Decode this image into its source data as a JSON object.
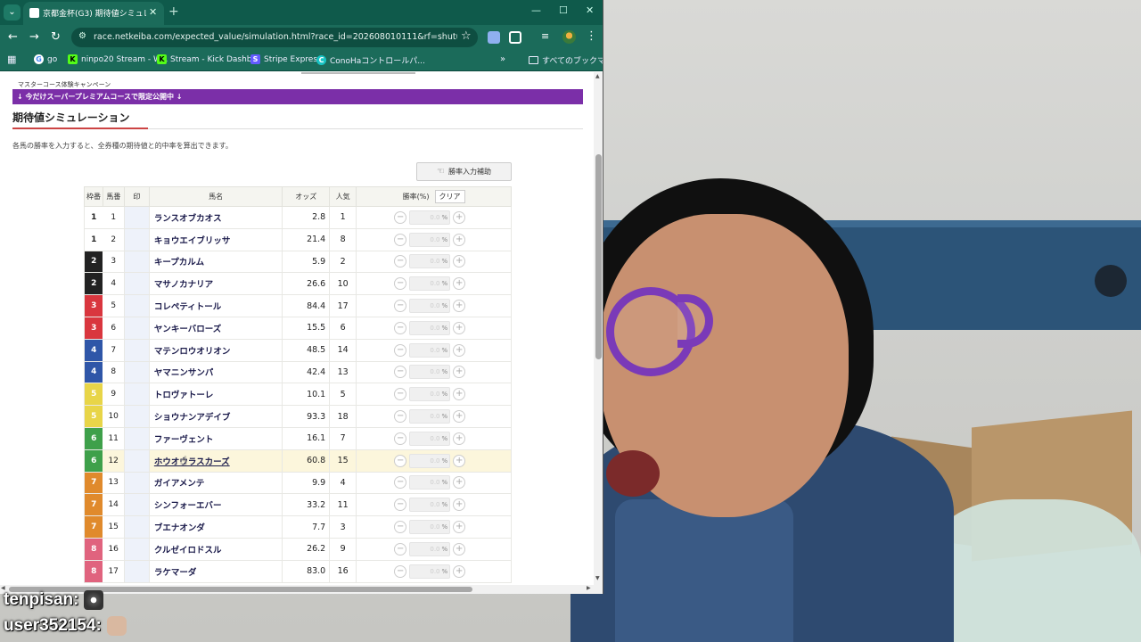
{
  "browser": {
    "tab_title": "京都金杯(G3) 期待値シミュレーショ",
    "tab_close": "✕",
    "new_tab": "+",
    "url": "race.netkeiba.com/expected_value/simulation.html?race_id=202608010111&rf=shutuba_submenu",
    "bookmarks": [
      "go",
      "ninpo20 Stream - W...",
      "Stream - Kick Dashb...",
      "Stripe Express",
      "ConoHaコントロールパ..."
    ],
    "bookmark_more": "»",
    "bookmark_folder": "すべてのブックマーク"
  },
  "page": {
    "campaign_label": "マスターコース体験キャンペーン",
    "premium_banner": "↓ 今だけスーパープレミアムコースで限定公開中 ↓",
    "title": "期待値シミュレーション",
    "description": "各馬の勝率を入力すると、全券種の期待値と的中率を算出できます。",
    "assist_button": "勝率入力補助",
    "headers": {
      "waku": "枠番",
      "umaban": "馬番",
      "mark": "印",
      "name": "馬名",
      "odds": "オッズ",
      "popularity": "人気",
      "rate": "勝率(%)",
      "clear": "クリア"
    },
    "rate_placeholder": "0.0",
    "rate_unit": "%",
    "minus": "−",
    "plus": "+",
    "waku_colors": {
      "1": {
        "bg": "#ffffff",
        "fg": "#222222"
      },
      "2": {
        "bg": "#222222",
        "fg": "#ffffff"
      },
      "3": {
        "bg": "#d9363e",
        "fg": "#ffffff"
      },
      "4": {
        "bg": "#2f56a8",
        "fg": "#ffffff"
      },
      "5": {
        "bg": "#e8d548",
        "fg": "#ffffff"
      },
      "6": {
        "bg": "#3ea04a",
        "fg": "#ffffff"
      },
      "7": {
        "bg": "#e08a2c",
        "fg": "#ffffff"
      },
      "8": {
        "bg": "#e0637e",
        "fg": "#ffffff"
      }
    },
    "horses": [
      {
        "waku": "1",
        "umaban": "1",
        "name": "ランスオブカオス",
        "odds": "2.8",
        "pop": "1"
      },
      {
        "waku": "1",
        "umaban": "2",
        "name": "キョウエイブリッサ",
        "odds": "21.4",
        "pop": "8"
      },
      {
        "waku": "2",
        "umaban": "3",
        "name": "キープカルム",
        "odds": "5.9",
        "pop": "2"
      },
      {
        "waku": "2",
        "umaban": "4",
        "name": "マサノカナリア",
        "odds": "26.6",
        "pop": "10"
      },
      {
        "waku": "3",
        "umaban": "5",
        "name": "コレペティトール",
        "odds": "84.4",
        "pop": "17"
      },
      {
        "waku": "3",
        "umaban": "6",
        "name": "ヤンキーバローズ",
        "odds": "15.5",
        "pop": "6"
      },
      {
        "waku": "4",
        "umaban": "7",
        "name": "マテンロウオリオン",
        "odds": "48.5",
        "pop": "14"
      },
      {
        "waku": "4",
        "umaban": "8",
        "name": "ヤマニンサンパ",
        "odds": "42.4",
        "pop": "13"
      },
      {
        "waku": "5",
        "umaban": "9",
        "name": "トロヴァトーレ",
        "odds": "10.1",
        "pop": "5"
      },
      {
        "waku": "5",
        "umaban": "10",
        "name": "ショウナンアデイブ",
        "odds": "93.3",
        "pop": "18"
      },
      {
        "waku": "6",
        "umaban": "11",
        "name": "ファーヴェント",
        "odds": "16.1",
        "pop": "7"
      },
      {
        "waku": "6",
        "umaban": "12",
        "name": "ホウオウラスカーズ",
        "odds": "60.8",
        "pop": "15",
        "hover": true
      },
      {
        "waku": "7",
        "umaban": "13",
        "name": "ガイアメンテ",
        "odds": "9.9",
        "pop": "4"
      },
      {
        "waku": "7",
        "umaban": "14",
        "name": "シンフォーエバー",
        "odds": "33.2",
        "pop": "11"
      },
      {
        "waku": "7",
        "umaban": "15",
        "name": "ブエナオンダ",
        "odds": "7.7",
        "pop": "3"
      },
      {
        "waku": "8",
        "umaban": "16",
        "name": "クルゼイロドスル",
        "odds": "26.2",
        "pop": "9"
      },
      {
        "waku": "8",
        "umaban": "17",
        "name": "ラケマーダ",
        "odds": "83.0",
        "pop": "16"
      }
    ]
  },
  "chat": [
    {
      "user": "tenpisan:"
    },
    {
      "user": "user352154:"
    }
  ]
}
